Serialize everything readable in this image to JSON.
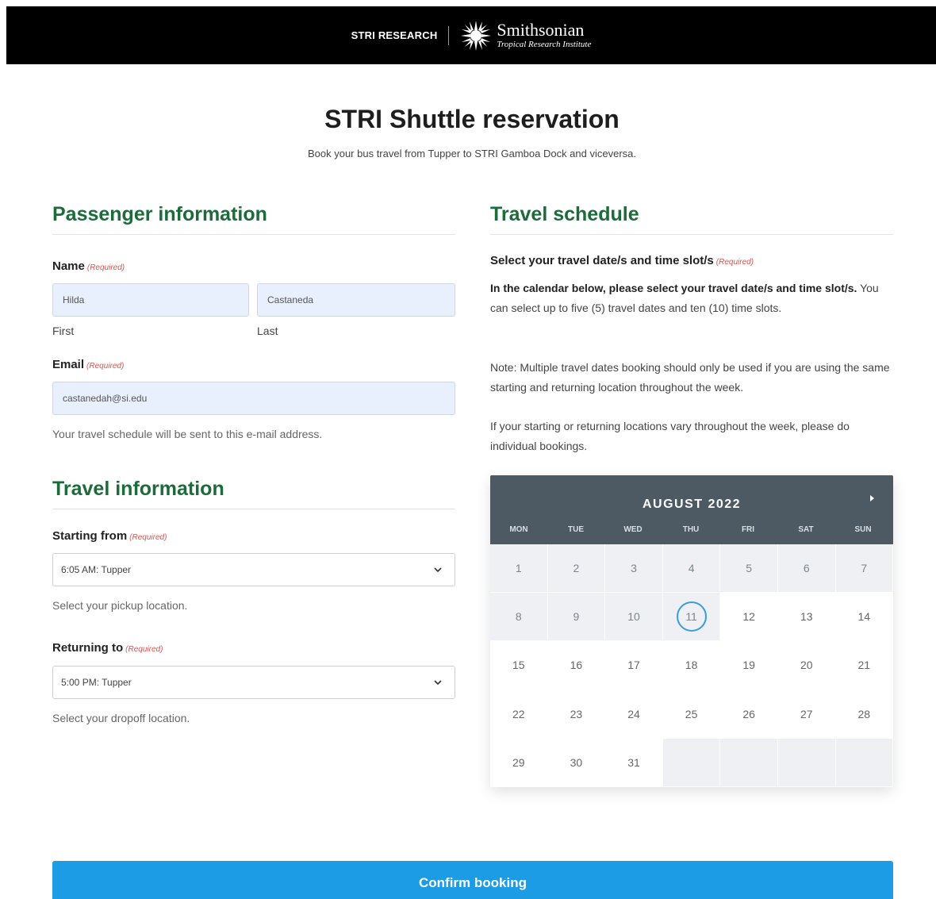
{
  "header": {
    "left_label": "STRI RESEARCH",
    "brand_name": "Smithsonian",
    "brand_sub": "Tropical Research Institute"
  },
  "page": {
    "title": "STRI Shuttle reservation",
    "subtitle": "Book your bus travel from Tupper to STRI Gamboa Dock and viceversa."
  },
  "required_tag": "(Required)",
  "passenger": {
    "heading": "Passenger information",
    "name_label": "Name",
    "first_value": "Hilda",
    "last_value": "Castaneda",
    "first_sub": "First",
    "last_sub": "Last",
    "email_label": "Email",
    "email_value": "castanedah@si.edu",
    "email_help": "Your travel schedule will be sent to this e-mail address."
  },
  "travel_info": {
    "heading": "Travel information",
    "start_label": "Starting from",
    "start_value": "6:05 AM: Tupper",
    "start_help": "Select your pickup location.",
    "return_label": "Returning to",
    "return_value": "5:00 PM: Tupper",
    "return_help": "Select your dropoff location."
  },
  "schedule": {
    "heading": "Travel schedule",
    "select_label": "Select your travel date/s and time slot/s",
    "instr_bold": "In the calendar below, please select your travel date/s and time slot/s.",
    "instr_rest": " You can select up to five (5) travel dates and ten (10) time slots.",
    "note": "Note: Multiple travel dates booking should only be used if you are using the same starting and returning location throughout the week.",
    "vary": "If your starting or returning locations vary throughout the week, please do individual bookings."
  },
  "calendar": {
    "month": "AUGUST 2022",
    "weekdays": [
      "MON",
      "TUE",
      "WED",
      "THU",
      "FRI",
      "SAT",
      "SUN"
    ],
    "today": 11,
    "weeks": [
      [
        1,
        2,
        3,
        4,
        5,
        6,
        7
      ],
      [
        8,
        9,
        10,
        11,
        12,
        13,
        14
      ],
      [
        15,
        16,
        17,
        18,
        19,
        20,
        21
      ],
      [
        22,
        23,
        24,
        25,
        26,
        27,
        28
      ],
      [
        29,
        30,
        31,
        null,
        null,
        null,
        null
      ]
    ]
  },
  "confirm_label": "Confirm booking",
  "colors": {
    "heading_green": "#1c6b3a",
    "primary_blue": "#1b9ce5",
    "calendar_header": "#4d5a64",
    "required_red": "#d9534f"
  }
}
